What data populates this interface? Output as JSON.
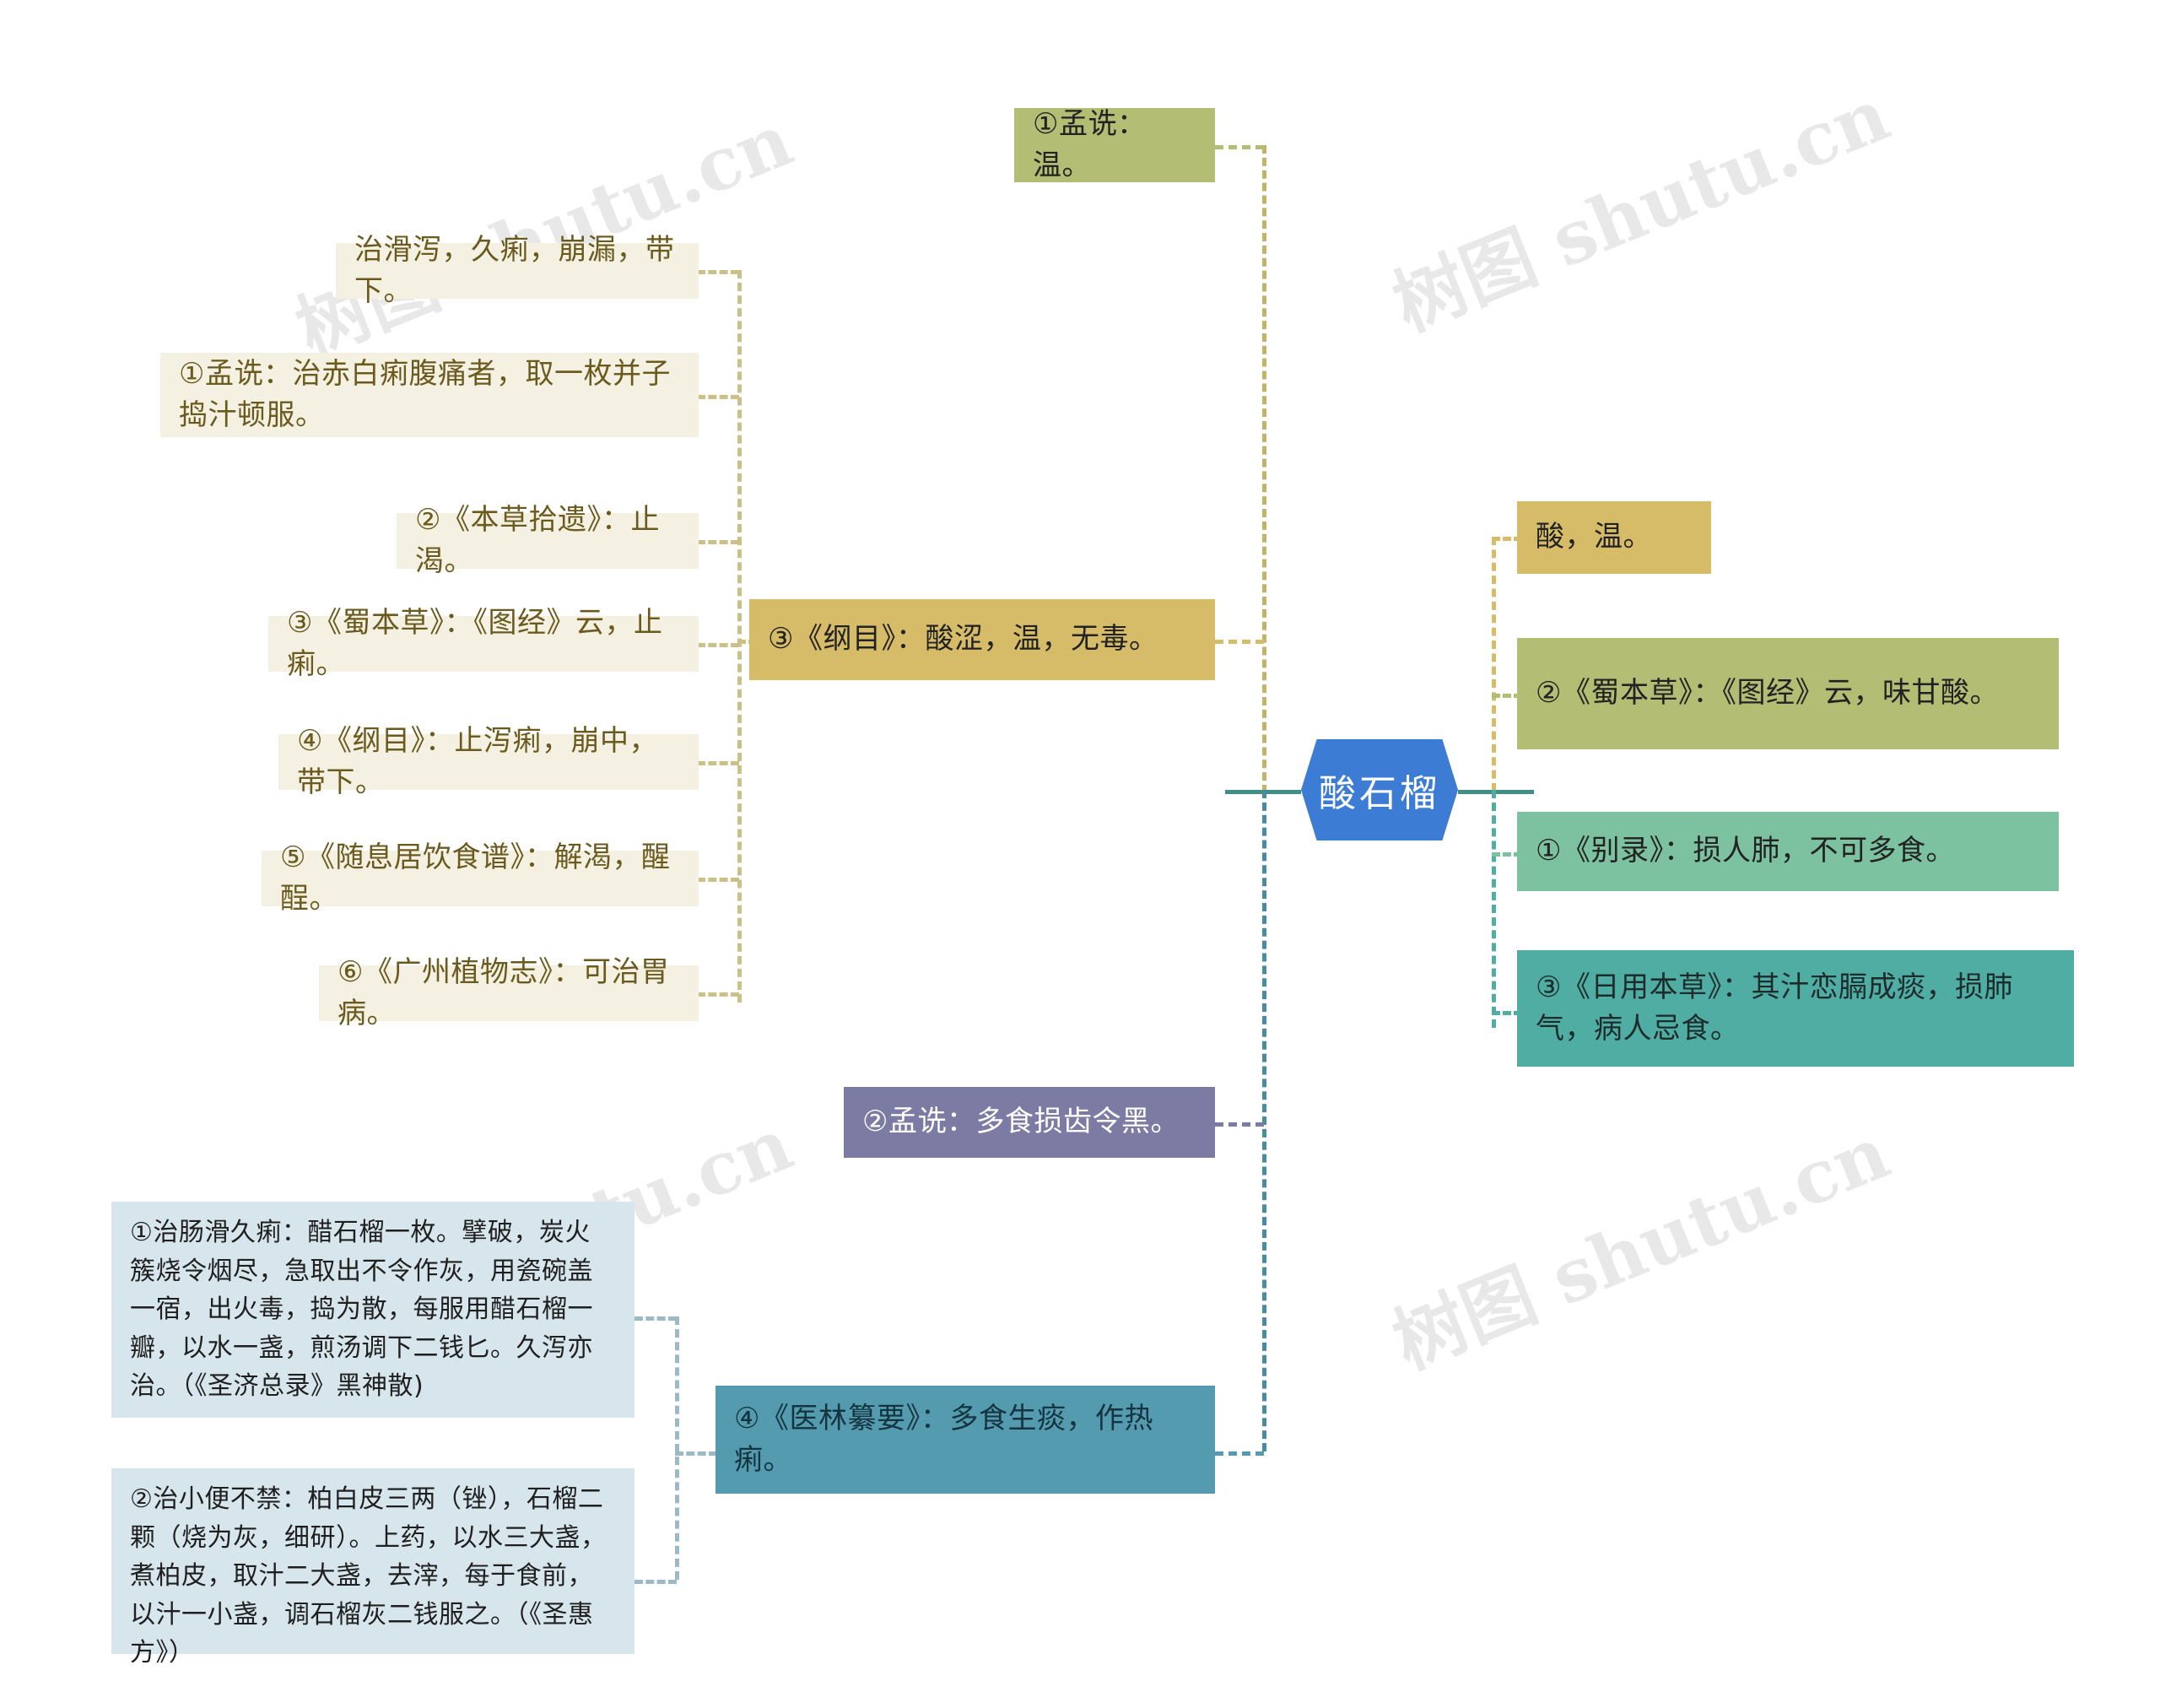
{
  "title": "酸石榴 思维导图",
  "root": {
    "label": "酸石榴"
  },
  "colors": {
    "root": "#3c7cd4",
    "leaf_cream": "#f4f1e2",
    "gold": "#d6bc68",
    "olive": "#b3bd73",
    "green": "#7cc1a0",
    "teal": "#4fada4",
    "steel": "#559bb0",
    "purple": "#7b7ba3",
    "lightblue": "#d7e6ec"
  },
  "watermark": {
    "text": "树图 shutu.cn"
  },
  "left_branch": {
    "gongxiao_node": "③《纲目》：酸涩，温，无毒。",
    "top_node": "①孟诜：温。",
    "items": [
      "治滑泻，久痢，崩漏，带下。",
      "①孟诜：治赤白痢腹痛者，取一枚并子捣汁顿服。",
      "②《本草拾遗》：止渴。",
      "③《蜀本草》：《图经》云，止痢。",
      "④《纲目》：止泻痢，崩中，带下。",
      "⑤《随息居饮食谱》：解渴，醒酲。",
      "⑥《广州植物志》：可治胃病。"
    ],
    "purple_node": "②孟诜：多食损齿令黑。",
    "steel_node": "④《医林纂要》：多食生痰，作热痢。",
    "fuf ang": [
      "①治肠滑久痢：醋石榴一枚。擘破，炭火簇烧令烟尽，急取出不令作灰，用瓷碗盖一宿，出火毒，捣为散，每服用醋石榴一瓣，以水一盏，煎汤调下二钱匕。久泻亦治。（《圣济总录》黑神散)",
      "②治小便不禁：柏白皮三两（锉），石榴二颗（烧为灰，细研）。上药，以水三大盏，煮柏皮，取汁二大盏，去滓，每于食前，以汁一小盏，调石榴灰二钱服之。（《圣惠方》）"
    ]
  },
  "right_branch": {
    "items": [
      {
        "text": "酸，温。",
        "style": "gold"
      },
      {
        "text": "②《蜀本草》：《图经》云，味甘酸。",
        "style": "olive"
      },
      {
        "text": "①《别录》：损人肺，不可多食。",
        "style": "green"
      },
      {
        "text": "③《日用本草》：其汁恋膈成痰，损肺气，病人忌食。",
        "style": "teal"
      }
    ]
  }
}
